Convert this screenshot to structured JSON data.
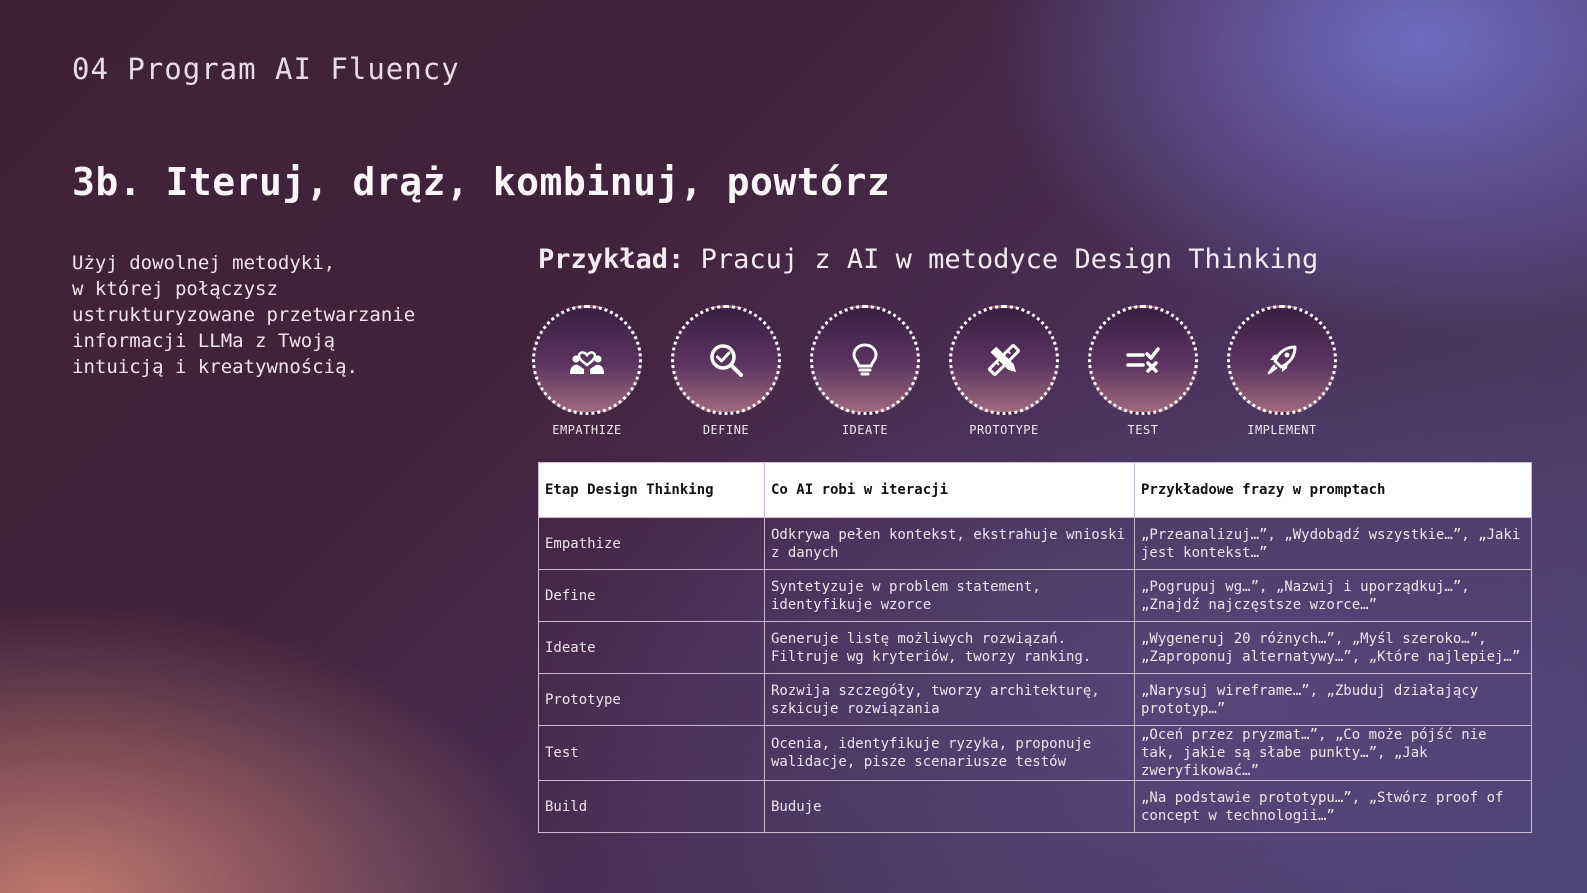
{
  "slide": {
    "kicker": "04 Program AI Fluency",
    "title": "3b. Iteruj, drąż, kombinuj, powtórz",
    "intro": "Użyj dowolnej metodyki,\nw której połączysz\nustrukturyzowane przetwarzanie\ninformacji LLMa z Twoją\nintuicją i kreatywnością.",
    "example_lead": "Przykład:",
    "example_text": " Pracuj z AI w metodyce Design Thinking"
  },
  "stages": [
    {
      "label": "EMPATHIZE",
      "icon": "people-heart-icon"
    },
    {
      "label": "DEFINE",
      "icon": "magnifier-check-icon"
    },
    {
      "label": "IDEATE",
      "icon": "lightbulb-icon"
    },
    {
      "label": "PROTOTYPE",
      "icon": "pencil-ruler-icon"
    },
    {
      "label": "TEST",
      "icon": "checklist-icon"
    },
    {
      "label": "IMPLEMENT",
      "icon": "rocket-icon"
    }
  ],
  "table": {
    "headers": [
      "Etap Design Thinking",
      "Co AI robi w iteracji",
      "Przykładowe frazy w promptach"
    ],
    "rows": [
      [
        "Empathize",
        "Odkrywa pełen kontekst, ekstrahuje wnioski z danych",
        "„Przeanalizuj…”, „Wydobądź wszystkie…”, „Jaki jest kontekst…”"
      ],
      [
        "Define",
        "Syntetyzuje w problem statement, identyfikuje wzorce",
        "„Pogrupuj wg…”, „Nazwij i uporządkuj…”, „Znajdź najczęstsze wzorce…”"
      ],
      [
        "Ideate",
        "Generuje listę możliwych rozwiązań. Filtruje wg kryteriów, tworzy ranking.",
        "„Wygeneruj 20 różnych…”, „Myśl szeroko…”, „Zaproponuj alternatywy…”, „Które najlepiej…”"
      ],
      [
        "Prototype",
        "Rozwija szczegóły, tworzy architekturę, szkicuje rozwiązania",
        "„Narysuj wireframe…”, „Zbuduj działający prototyp…”"
      ],
      [
        "Test",
        "Ocenia, identyfikuje ryzyka, proponuje walidacje, pisze scenariusze testów",
        "„Oceń przez pryzmat…”, „Co może pójść nie tak, jakie są słabe punkty…”, „Jak zweryfikować…”"
      ],
      [
        "Build",
        "Buduje",
        "„Na podstawie prototypu…”, „Stwórz proof of concept w technologii…”"
      ]
    ]
  }
}
